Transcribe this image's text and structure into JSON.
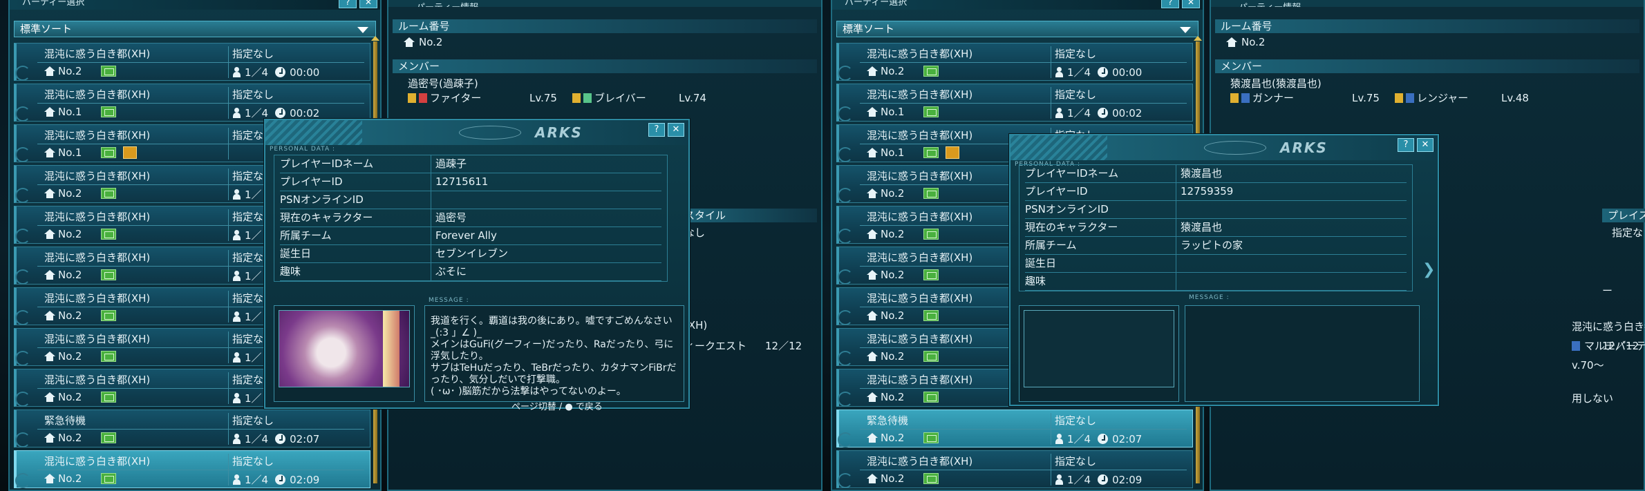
{
  "left": {
    "party_select": {
      "title": "パーティー選択",
      "sort_label": "標準ソート",
      "rows": [
        {
          "quest": "混沌に惑う白き都(XH)",
          "desc": "指定なし",
          "room": "No.2",
          "players": "1／4",
          "time": "00:00",
          "lock": false,
          "highlight": false
        },
        {
          "quest": "混沌に惑う白き都(XH)",
          "desc": "指定なし",
          "room": "No.1",
          "players": "1／4",
          "time": "00:02",
          "lock": false,
          "highlight": false
        },
        {
          "quest": "混沌に惑う白き都(XH)",
          "desc": "指定なし",
          "room": "No.1",
          "players": "",
          "time": "",
          "lock": true,
          "highlight": false
        },
        {
          "quest": "混沌に惑う白き都(XH)",
          "desc": "指定な",
          "room": "No.2",
          "players": "1／",
          "time": "",
          "lock": false,
          "highlight": false
        },
        {
          "quest": "混沌に惑う白き都(XH)",
          "desc": "指定な",
          "room": "No.2",
          "players": "1／",
          "time": "",
          "lock": false,
          "highlight": false
        },
        {
          "quest": "混沌に惑う白き都(XH)",
          "desc": "指定な",
          "room": "No.2",
          "players": "1／",
          "time": "",
          "lock": false,
          "highlight": false
        },
        {
          "quest": "混沌に惑う白き都(XH)",
          "desc": "指定な",
          "room": "No.2",
          "players": "1／",
          "time": "",
          "lock": false,
          "highlight": false
        },
        {
          "quest": "混沌に惑う白き都(XH)",
          "desc": "指定な",
          "room": "No.2",
          "players": "1／",
          "time": "",
          "lock": false,
          "highlight": false
        },
        {
          "quest": "混沌に惑う白き都(XH)",
          "desc": "指定な",
          "room": "No.2",
          "players": "1／",
          "time": "",
          "lock": false,
          "highlight": false
        },
        {
          "quest": "緊急待機",
          "desc": "指定なし",
          "room": "No.2",
          "players": "1／4",
          "time": "02:07",
          "lock": false,
          "highlight": false
        },
        {
          "quest": "混沌に惑う白き都(XH)",
          "desc": "指定なし",
          "room": "No.2",
          "players": "1／4",
          "time": "02:09",
          "lock": false,
          "highlight": true
        }
      ]
    },
    "party_info": {
      "title": "パーティー情報",
      "room_header": "ルーム番号",
      "room_no": "No.2",
      "members_header": "メンバー",
      "member_name": "過密号(過疎子)",
      "main_class": "ファイター",
      "main_lv": "Lv.75",
      "sub_class": "ブレイバー",
      "sub_lv": "Lv.74",
      "playstyle_frag": "スタイル",
      "playstyle_value_frag": "なし",
      "quest_frag": "(XH)",
      "quest_type_frag": "ィークエスト",
      "quest_count": "12／12"
    },
    "personal_data": {
      "label": "PERSONAL DATA :",
      "fields": [
        {
          "key": "プレイヤーIDネーム",
          "value": "過疎子"
        },
        {
          "key": "プレイヤーID",
          "value": "12715611"
        },
        {
          "key": "PSNオンラインID",
          "value": ""
        },
        {
          "key": "現在のキャラクター",
          "value": "過密号"
        },
        {
          "key": "所属チーム",
          "value": "Forever Ally"
        },
        {
          "key": "誕生日",
          "value": "セブンイレブン"
        },
        {
          "key": "趣味",
          "value": "ぶそに"
        }
      ],
      "message_label": "MESSAGE :",
      "message": "我道を行く。覇道は我の後にあり。嘘ですごめんなさい_(:3 」∠ )_\nメインはGuFi(グーフィー)だったり、Raだったり、弓に浮気したり。\nサブはTeHuだったり、TeBrだったり、カタナマンFiBrだったり、気分しだいで打撃職。\n( ･ω･ )脳筋だから法撃はやってないのよー。",
      "footer": "ページ切替 / ● で戻る"
    }
  },
  "right": {
    "party_select": {
      "title": "パーティー選択",
      "sort_label": "標準ソート",
      "rows": [
        {
          "quest": "混沌に惑う白き都(XH)",
          "desc": "指定なし",
          "room": "No.2",
          "players": "1／4",
          "time": "00:00",
          "lock": false,
          "highlight": false
        },
        {
          "quest": "混沌に惑う白き都(XH)",
          "desc": "指定なし",
          "room": "No.1",
          "players": "1／4",
          "time": "00:02",
          "lock": false,
          "highlight": false
        },
        {
          "quest": "混沌に惑う白き都(XH)",
          "desc": "指定なし",
          "room": "No.1",
          "players": "",
          "time": "",
          "lock": true,
          "highlight": false
        },
        {
          "quest": "混沌に惑う白き都(XH)",
          "desc": "",
          "room": "No.2",
          "players": "",
          "time": "",
          "lock": false,
          "highlight": false
        },
        {
          "quest": "混沌に惑う白き都(XH)",
          "desc": "",
          "room": "No.2",
          "players": "",
          "time": "",
          "lock": false,
          "highlight": false
        },
        {
          "quest": "混沌に惑う白き都(XH)",
          "desc": "",
          "room": "No.2",
          "players": "",
          "time": "",
          "lock": false,
          "highlight": false
        },
        {
          "quest": "混沌に惑う白き都(XH)",
          "desc": "",
          "room": "No.2",
          "players": "",
          "time": "",
          "lock": false,
          "highlight": false
        },
        {
          "quest": "混沌に惑う白き都(XH)",
          "desc": "",
          "room": "No.2",
          "players": "",
          "time": "",
          "lock": false,
          "highlight": false
        },
        {
          "quest": "混沌に惑う白き都(XH)",
          "desc": "",
          "room": "No.2",
          "players": "",
          "time": "",
          "lock": false,
          "highlight": false
        },
        {
          "quest": "緊急待機",
          "desc": "指定なし",
          "room": "No.2",
          "players": "1／4",
          "time": "02:07",
          "lock": false,
          "highlight": true
        },
        {
          "quest": "混沌に惑う白き都(XH)",
          "desc": "指定なし",
          "room": "No.2",
          "players": "1／4",
          "time": "02:09",
          "lock": false,
          "highlight": false
        }
      ]
    },
    "party_info": {
      "title": "パーティー情報",
      "room_header": "ルーム番号",
      "room_no": "No.2",
      "members_header": "メンバー",
      "member_name": "猿渡昌也(猿渡昌也)",
      "main_class": "ガンナー",
      "main_lv": "Lv.75",
      "sub_class": "レンジャー",
      "sub_lv": "Lv.48",
      "playstyle_header": "プレイスタイル",
      "playstyle_value": "指定なし",
      "dash": "ー",
      "quest_frag": "混沌に惑う白き都(XH)",
      "quest_type": "マルチパーティークエスト",
      "quest_count": "12／12",
      "level_frag": "v.70〜",
      "use_frag": "用しない"
    },
    "personal_data": {
      "label": "PERSONAL DATA :",
      "fields": [
        {
          "key": "プレイヤーIDネーム",
          "value": "猿渡昌也"
        },
        {
          "key": "プレイヤーID",
          "value": "12759359"
        },
        {
          "key": "PSNオンラインID",
          "value": ""
        },
        {
          "key": "現在のキャラクター",
          "value": "猿渡昌也"
        },
        {
          "key": "所属チーム",
          "value": "ラッピトの家"
        },
        {
          "key": "誕生日",
          "value": ""
        },
        {
          "key": "趣味",
          "value": ""
        }
      ],
      "message_label": "MESSAGE :",
      "message": "",
      "next_icon": "chevron-right-icon"
    }
  },
  "icons": {
    "help": "?",
    "close": "✕"
  }
}
